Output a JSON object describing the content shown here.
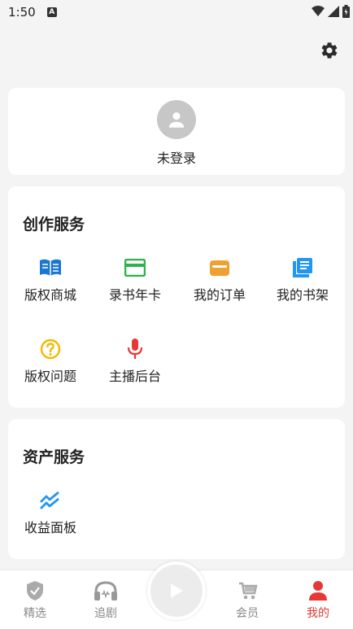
{
  "status": {
    "time": "1:50",
    "notification_letter": "A"
  },
  "profile": {
    "login_text": "未登录"
  },
  "creation": {
    "title": "创作服务",
    "items": [
      {
        "label": "版权商城",
        "icon": "book-icon",
        "color": "#1976d2"
      },
      {
        "label": "录书年卡",
        "icon": "card-icon",
        "color": "#2eb24a"
      },
      {
        "label": "我的订单",
        "icon": "wallet-icon",
        "color": "#f0a030"
      },
      {
        "label": "我的书架",
        "icon": "bookshelf-icon",
        "color": "#2196f3"
      },
      {
        "label": "版权问题",
        "icon": "question-icon",
        "color": "#f5b800"
      },
      {
        "label": "主播后台",
        "icon": "microphone-icon",
        "color": "#e53935"
      }
    ]
  },
  "assets": {
    "title": "资产服务",
    "items": [
      {
        "label": "收益面板",
        "icon": "trend-icon",
        "color": "#2196f3"
      }
    ]
  },
  "nav": [
    {
      "label": "精选",
      "icon": "shield-icon",
      "active": false
    },
    {
      "label": "追剧",
      "icon": "headphones-icon",
      "active": false
    },
    {
      "label": "会员",
      "icon": "cart-icon",
      "active": false
    },
    {
      "label": "我的",
      "icon": "person-icon",
      "active": true
    }
  ],
  "colors": {
    "accent": "#e53935",
    "inactive": "#888888"
  }
}
